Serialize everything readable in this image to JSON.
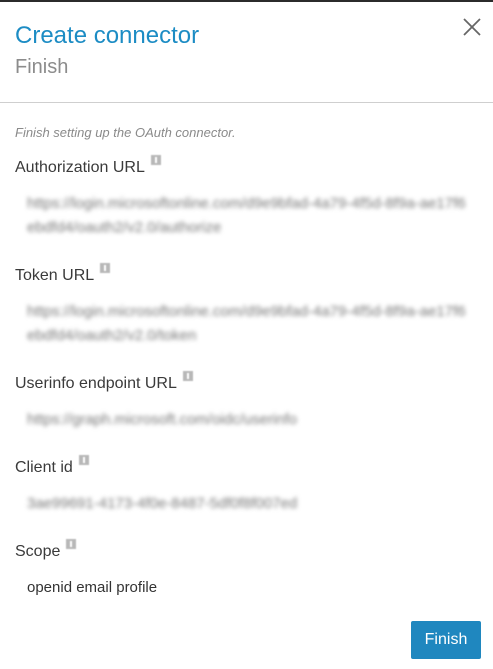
{
  "dialog": {
    "title": "Create connector",
    "subtitle": "Finish",
    "intro": "Finish setting up the OAuth connector."
  },
  "fields": [
    {
      "label": "Authorization URL",
      "value": "https://login.microsoftonline.com/d9e9bfad-4a79-4f5d-8f9a-ae17f6ebdfd4/oauth2/v2.0/authorize",
      "icon": "info-icon"
    },
    {
      "label": "Token URL",
      "value": "https://login.microsoftonline.com/d9e9bfad-4a79-4f5d-8f9a-ae17f6ebdfd4/oauth2/v2.0/token",
      "icon": "info-icon"
    },
    {
      "label": "Userinfo endpoint URL",
      "value": "https://graph.microsoft.com/oidc/userinfo",
      "icon": "info-icon"
    },
    {
      "label": "Client id",
      "value": "3ae99691-4173-4f0e-8487-5df0f8f007ed",
      "icon": "info-icon"
    },
    {
      "label": "Scope",
      "value": "openid email profile",
      "icon": "info-icon"
    }
  ],
  "actions": {
    "finish_label": "Finish",
    "close_icon": "close-icon"
  },
  "colors": {
    "accent": "#1c8cc4",
    "button": "#1f87bf"
  }
}
